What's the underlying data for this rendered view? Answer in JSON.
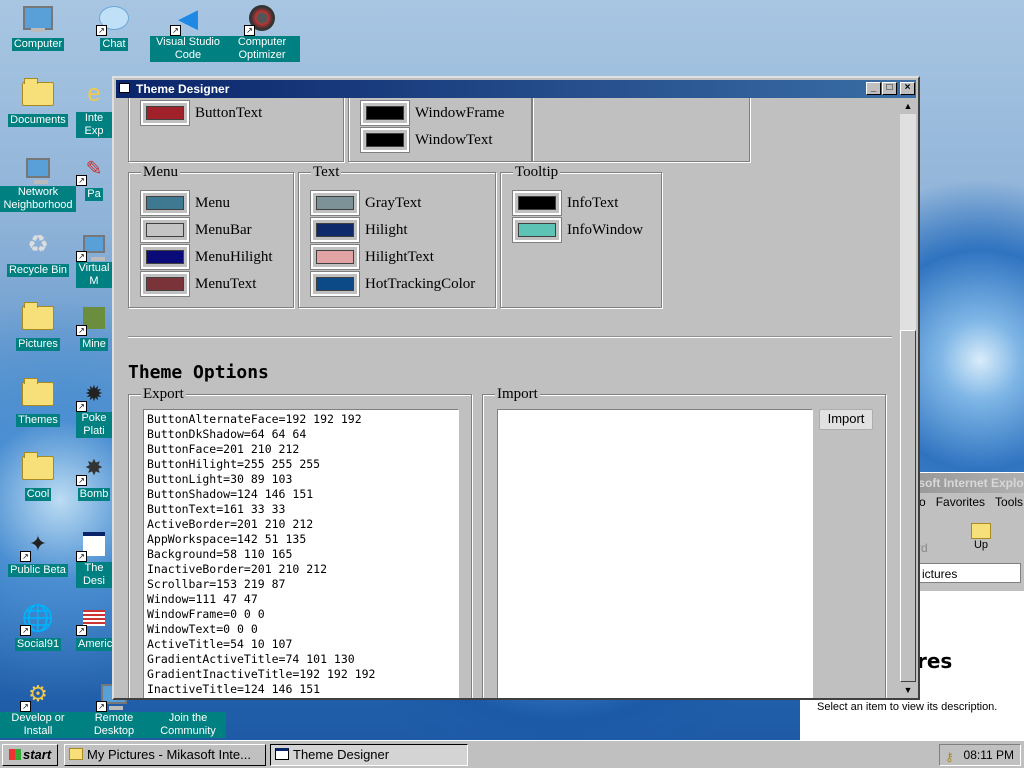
{
  "desktop": {
    "icons": [
      {
        "label": "Computer",
        "icon": "computer-icon"
      },
      {
        "label": "Chat",
        "icon": "chat-bubble-icon"
      },
      {
        "label": "Visual Studio Code",
        "icon": "vscode-icon"
      },
      {
        "label": "Computer Optimizer",
        "icon": "gauge-icon"
      },
      {
        "label": "Documents",
        "icon": "folder-icon"
      },
      {
        "label": "Inte Exp",
        "icon": "internet-explorer-icon"
      },
      {
        "label": "Network Neighborhood",
        "icon": "network-icon"
      },
      {
        "label": "Pa",
        "icon": "paint-icon"
      },
      {
        "label": "Recycle Bin",
        "icon": "recycle-bin-icon"
      },
      {
        "label": "Virtual M",
        "icon": "virtual-machine-icon"
      },
      {
        "label": "Pictures",
        "icon": "folder-icon"
      },
      {
        "label": "Mine",
        "icon": "minecraft-icon"
      },
      {
        "label": "Themes",
        "icon": "folder-icon"
      },
      {
        "label": "Poke Plati",
        "icon": "game-icon"
      },
      {
        "label": "Cool",
        "icon": "folder-icon"
      },
      {
        "label": "Bomb",
        "icon": "bomb-icon"
      },
      {
        "label": "Public Beta",
        "icon": "beta-icon"
      },
      {
        "label": "The Desi",
        "icon": "window-icon"
      },
      {
        "label": "Social91",
        "icon": "globe-icon"
      },
      {
        "label": "America",
        "icon": "flag-icon"
      },
      {
        "label": "Develop or Install",
        "icon": "setup-icon"
      },
      {
        "label": "Remote Desktop",
        "icon": "remote-desktop-icon"
      },
      {
        "label": "Join the Community",
        "icon": "community-icon"
      }
    ]
  },
  "ie_window": {
    "title": "osoft Internet Explo",
    "menu": [
      "o",
      "Favorites",
      "Tools"
    ],
    "up_label": "Up",
    "forward_fragment": "rd",
    "address": "ictures",
    "heading": "res",
    "description": "Select an item to view its description."
  },
  "theme_designer": {
    "title": "Theme Designer",
    "buttons": {
      "minimize": "_",
      "maximize": "□",
      "close": "×"
    },
    "groups": {
      "button_partial": {
        "items": [
          {
            "label": "ButtonText",
            "color": "#a1212b"
          }
        ]
      },
      "window_partial": {
        "items": [
          {
            "label": "WindowFrame",
            "color": "#000000"
          },
          {
            "label": "WindowText",
            "color": "#000000"
          }
        ]
      },
      "menu": {
        "legend": "Menu",
        "items": [
          {
            "label": "Menu",
            "color": "#3e7891"
          },
          {
            "label": "MenuBar",
            "color": "#c4c4c4"
          },
          {
            "label": "MenuHilight",
            "color": "#0a0a78"
          },
          {
            "label": "MenuText",
            "color": "#7a3338"
          }
        ]
      },
      "text": {
        "legend": "Text",
        "items": [
          {
            "label": "GrayText",
            "color": "#7c9297"
          },
          {
            "label": "Hilight",
            "color": "#0f2a6a"
          },
          {
            "label": "HilightText",
            "color": "#e1a3a3"
          },
          {
            "label": "HotTrackingColor",
            "color": "#0b4a86"
          }
        ]
      },
      "tooltip": {
        "legend": "Tooltip",
        "items": [
          {
            "label": "InfoText",
            "color": "#000000"
          },
          {
            "label": "InfoWindow",
            "color": "#5dc3b5"
          }
        ]
      }
    },
    "options_title": "Theme Options",
    "export": {
      "legend": "Export",
      "lines": [
        "ButtonAlternateFace=192 192 192",
        "ButtonDkShadow=64 64 64",
        "ButtonFace=201 210 212",
        "ButtonHilight=255 255 255",
        "ButtonLight=30 89 103",
        "ButtonShadow=124 146 151",
        "ButtonText=161 33 33",
        "ActiveBorder=201 210 212",
        "AppWorkspace=142 51 135",
        "Background=58 110 165",
        "InactiveBorder=201 210 212",
        "Scrollbar=153 219 87",
        "Window=111 47 47",
        "WindowFrame=0 0 0",
        "WindowText=0 0 0",
        "ActiveTitle=54 10 107",
        "GradientActiveTitle=74 101 130",
        "GradientInactiveTitle=192 192 192",
        "InactiveTitle=124 146 151"
      ]
    },
    "import": {
      "legend": "Import",
      "button": "Import",
      "value": ""
    }
  },
  "taskbar": {
    "start": "start",
    "tasks": [
      {
        "label": "My Pictures - Mikasoft Inte..."
      },
      {
        "label": "Theme Designer"
      }
    ],
    "clock": "08:11 PM"
  }
}
